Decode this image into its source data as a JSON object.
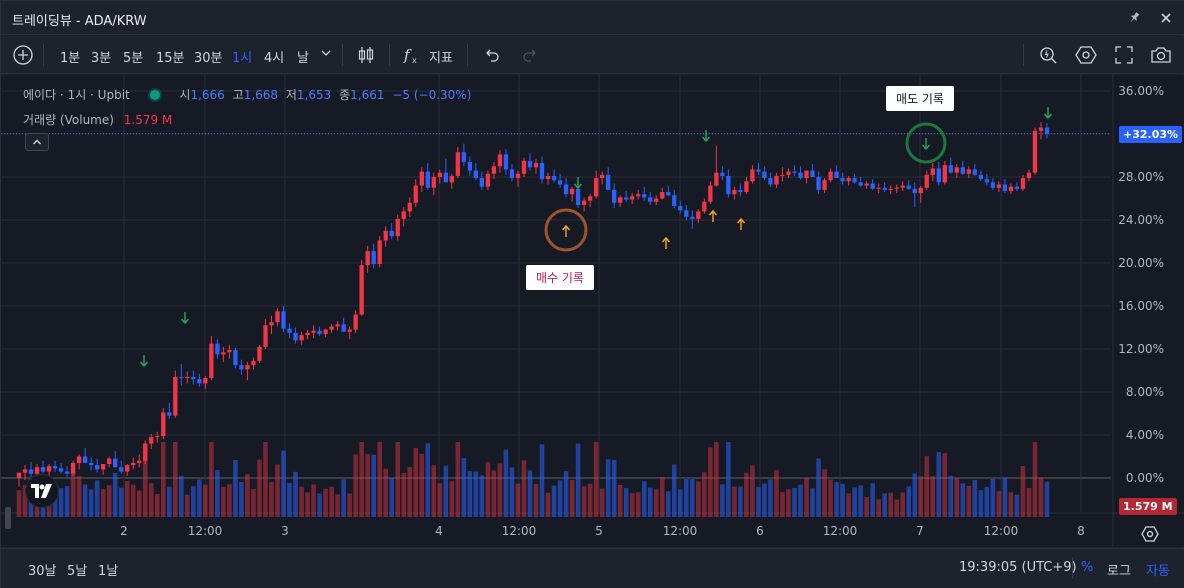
{
  "window": {
    "title": "트레이딩뷰 - ADA/KRW",
    "pin_icon": "pin-icon",
    "close_icon": "close-icon"
  },
  "toolbar": {
    "add_icon": "plus-circle-icon",
    "intervals": [
      "1분",
      "3분",
      "5분",
      "15분",
      "30분",
      "1시",
      "4시",
      "날"
    ],
    "active_interval": "1시",
    "chart_type_icon": "candles-icon",
    "indicators_label": "지표",
    "undo_icon": "undo-icon",
    "redo_icon": "redo-icon",
    "right_icons": [
      "quick-search-icon",
      "settings-hex-icon",
      "fullscreen-icon",
      "camera-icon"
    ]
  },
  "legend": {
    "symbol": "에이다 · 1시 · Upbit",
    "status_color": "#089981",
    "o_label": "시",
    "o_value": "1,666",
    "h_label": "고",
    "h_value": "1,668",
    "l_label": "저",
    "l_value": "1,653",
    "c_label": "종",
    "c_value": "1,661",
    "change": "−5 (−0.30%)",
    "volume_label": "거래량 (Volume)",
    "volume_value": "1.579 M"
  },
  "annotations": {
    "buy_label": "매수 기록",
    "sell_label": "매도 기록"
  },
  "price_axis": {
    "labels": [
      "36.00%",
      "32.00%",
      "28.00%",
      "24.00%",
      "20.00%",
      "16.00%",
      "12.00%",
      "8.00%",
      "4.00%",
      "0.00%"
    ],
    "last_tag": "+32.03%",
    "volume_tag": "1.579 M"
  },
  "time_axis": {
    "labels": [
      "2",
      "12:00",
      "3",
      "4",
      "12:00",
      "5",
      "12:00",
      "6",
      "12:00",
      "7",
      "12:00",
      "8"
    ]
  },
  "bottom": {
    "ranges": [
      "30날",
      "5날",
      "1날"
    ],
    "clock": "19:39:05 (UTC+9)",
    "percent_label": "%",
    "log_label": "로그",
    "auto_label": "자동"
  },
  "colors": {
    "up": "#f23645",
    "down": "#2962ff",
    "background": "#161a25",
    "grid": "#2a2e39",
    "accent": "#2962ff",
    "buy_circle": "#a0522d",
    "sell_circle": "#1b7a3a"
  },
  "chart_data": {
    "type": "candlestick",
    "yaxis": "percent",
    "ylim": [
      -2,
      38
    ],
    "last_value_pct": 32.03,
    "candles_pct": [
      [
        0,
        0.2,
        -0.8,
        0.5
      ],
      [
        0.5,
        1.2,
        -0.2,
        0.8
      ],
      [
        0.8,
        1.5,
        0.1,
        0.4
      ],
      [
        0.4,
        1.3,
        0.1,
        1.0
      ],
      [
        1.0,
        1.6,
        0.5,
        0.6
      ],
      [
        0.6,
        1.3,
        0.2,
        1.1
      ],
      [
        1.1,
        1.6,
        0.6,
        0.9
      ],
      [
        0.9,
        1.4,
        0.4,
        0.6
      ],
      [
        0.6,
        1.1,
        0.1,
        0.4
      ],
      [
        0.4,
        1.6,
        0.2,
        1.4
      ],
      [
        1.4,
        2.2,
        0.8,
        2.0
      ],
      [
        2.0,
        2.8,
        1.5,
        1.4
      ],
      [
        1.4,
        1.9,
        0.7,
        1.2
      ],
      [
        1.2,
        1.8,
        0.5,
        0.8
      ],
      [
        0.8,
        1.3,
        0.3,
        1.3
      ],
      [
        1.3,
        2.0,
        1.0,
        1.8
      ],
      [
        1.8,
        2.5,
        1.3,
        1.0
      ],
      [
        1.0,
        1.6,
        0.4,
        0.6
      ],
      [
        0.6,
        1.3,
        0.2,
        1.2
      ],
      [
        1.2,
        1.9,
        0.8,
        1.4
      ],
      [
        1.4,
        2.2,
        1.0,
        1.6
      ],
      [
        1.6,
        3.5,
        1.3,
        3.2
      ],
      [
        3.2,
        4.1,
        2.7,
        3.8
      ],
      [
        3.8,
        4.3,
        3.3,
        3.9
      ],
      [
        3.9,
        6.5,
        3.6,
        6.1
      ],
      [
        6.1,
        7.0,
        5.5,
        5.8
      ],
      [
        5.8,
        10.0,
        5.6,
        9.4
      ],
      [
        9.4,
        10.6,
        8.6,
        9.3
      ],
      [
        9.3,
        9.9,
        8.8,
        9.4
      ],
      [
        9.4,
        10.0,
        8.7,
        9.2
      ],
      [
        9.2,
        9.7,
        8.5,
        8.8
      ],
      [
        8.8,
        9.5,
        8.3,
        9.3
      ],
      [
        9.3,
        13.2,
        9.1,
        12.5
      ],
      [
        12.5,
        12.9,
        11.1,
        11.5
      ],
      [
        11.5,
        12.2,
        10.8,
        11.7
      ],
      [
        11.7,
        12.4,
        11.1,
        11.9
      ],
      [
        11.9,
        12.1,
        10.2,
        10.5
      ],
      [
        10.5,
        11.0,
        9.6,
        10.1
      ],
      [
        10.1,
        10.8,
        9.1,
        10.5
      ],
      [
        10.5,
        11.2,
        10.1,
        10.9
      ],
      [
        10.9,
        12.4,
        10.7,
        12.2
      ],
      [
        12.2,
        14.8,
        12.0,
        14.2
      ],
      [
        14.2,
        15.1,
        13.4,
        14.5
      ],
      [
        14.5,
        15.8,
        14.1,
        15.5
      ],
      [
        15.5,
        16.0,
        13.6,
        13.9
      ],
      [
        13.9,
        14.4,
        13.0,
        13.5
      ],
      [
        13.5,
        14.0,
        12.5,
        12.8
      ],
      [
        12.8,
        13.6,
        12.4,
        13.3
      ],
      [
        13.3,
        13.8,
        12.9,
        13.5
      ],
      [
        13.5,
        14.2,
        13.0,
        13.7
      ],
      [
        13.7,
        14.1,
        13.2,
        13.4
      ],
      [
        13.4,
        13.9,
        13.1,
        13.8
      ],
      [
        13.8,
        14.3,
        13.5,
        14.1
      ],
      [
        14.1,
        14.6,
        13.7,
        14.3
      ],
      [
        14.3,
        14.9,
        13.9,
        13.6
      ],
      [
        13.6,
        14.1,
        12.9,
        13.8
      ],
      [
        13.8,
        15.6,
        13.5,
        15.2
      ],
      [
        15.2,
        20.3,
        15.1,
        19.8
      ],
      [
        19.8,
        21.6,
        19.1,
        21.1
      ],
      [
        21.1,
        21.8,
        19.5,
        19.9
      ],
      [
        19.9,
        22.5,
        19.6,
        22.1
      ],
      [
        22.1,
        23.4,
        21.5,
        23.0
      ],
      [
        23.0,
        23.7,
        22.2,
        22.5
      ],
      [
        22.5,
        24.5,
        22.1,
        24.1
      ],
      [
        24.1,
        25.2,
        23.4,
        24.8
      ],
      [
        24.8,
        26.1,
        24.3,
        25.6
      ],
      [
        25.6,
        27.8,
        25.2,
        27.2
      ],
      [
        27.2,
        28.9,
        26.6,
        28.5
      ],
      [
        28.5,
        29.3,
        26.8,
        27.0
      ],
      [
        27.0,
        28.4,
        26.3,
        28.0
      ],
      [
        28.0,
        28.7,
        27.4,
        28.4
      ],
      [
        28.4,
        29.7,
        28.1,
        27.5
      ],
      [
        27.5,
        28.3,
        26.9,
        28.1
      ],
      [
        28.1,
        30.8,
        27.9,
        30.3
      ],
      [
        30.3,
        31.1,
        29.0,
        29.4
      ],
      [
        29.4,
        29.9,
        28.1,
        28.6
      ],
      [
        28.6,
        29.3,
        27.7,
        27.9
      ],
      [
        27.9,
        28.5,
        26.8,
        27.1
      ],
      [
        27.1,
        28.6,
        26.8,
        28.3
      ],
      [
        28.3,
        29.4,
        27.8,
        29.0
      ],
      [
        29.0,
        30.5,
        28.4,
        30.1
      ],
      [
        30.1,
        30.6,
        28.2,
        28.7
      ],
      [
        28.7,
        29.2,
        27.6,
        27.9
      ],
      [
        27.9,
        28.6,
        27.1,
        28.3
      ],
      [
        28.3,
        29.8,
        28.0,
        29.5
      ],
      [
        29.5,
        30.2,
        28.6,
        28.9
      ],
      [
        28.9,
        29.7,
        28.3,
        29.3
      ],
      [
        29.3,
        29.9,
        27.4,
        27.8
      ],
      [
        27.8,
        28.4,
        27.3,
        28.1
      ],
      [
        28.1,
        28.7,
        27.5,
        27.7
      ],
      [
        27.7,
        28.3,
        27.0,
        27.3
      ],
      [
        27.3,
        27.9,
        26.1,
        26.4
      ],
      [
        26.4,
        27.1,
        25.7,
        26.9
      ],
      [
        26.9,
        27.5,
        25.1,
        25.4
      ],
      [
        25.4,
        26.1,
        24.8,
        25.8
      ],
      [
        25.8,
        26.4,
        25.2,
        26.2
      ],
      [
        26.2,
        28.6,
        26.0,
        27.9
      ],
      [
        27.9,
        28.5,
        27.3,
        28.2
      ],
      [
        28.2,
        28.9,
        27.4,
        26.8
      ],
      [
        26.8,
        27.4,
        25.1,
        25.6
      ],
      [
        25.6,
        26.3,
        25.2,
        26.1
      ],
      [
        26.1,
        26.7,
        25.7,
        25.9
      ],
      [
        25.9,
        26.5,
        25.5,
        26.2
      ],
      [
        26.2,
        26.8,
        25.9,
        26.4
      ],
      [
        26.4,
        27.1,
        25.8,
        26.1
      ],
      [
        26.1,
        26.6,
        25.4,
        25.7
      ],
      [
        25.7,
        26.3,
        25.4,
        26.0
      ],
      [
        26.0,
        27.0,
        25.9,
        26.6
      ],
      [
        26.6,
        27.2,
        26.2,
        26.3
      ],
      [
        26.3,
        26.8,
        25.1,
        25.3
      ],
      [
        25.3,
        25.8,
        24.6,
        24.9
      ],
      [
        24.9,
        25.4,
        24.0,
        24.3
      ],
      [
        24.3,
        24.9,
        23.2,
        24.1
      ],
      [
        24.1,
        25.0,
        23.7,
        24.8
      ],
      [
        24.8,
        26.0,
        24.6,
        25.7
      ],
      [
        25.7,
        27.6,
        25.5,
        27.2
      ],
      [
        27.2,
        30.9,
        27.1,
        28.4
      ],
      [
        28.4,
        29.0,
        27.7,
        28.1
      ],
      [
        28.1,
        28.7,
        26.1,
        26.4
      ],
      [
        26.4,
        27.1,
        25.9,
        26.8
      ],
      [
        26.8,
        27.4,
        26.2,
        26.6
      ],
      [
        26.6,
        28.0,
        26.4,
        27.6
      ],
      [
        27.6,
        29.1,
        27.4,
        28.7
      ],
      [
        28.7,
        29.3,
        28.2,
        28.5
      ],
      [
        28.5,
        29.0,
        27.7,
        27.9
      ],
      [
        27.9,
        28.4,
        27.1,
        27.3
      ],
      [
        27.3,
        28.4,
        27.0,
        28.1
      ],
      [
        28.1,
        28.9,
        27.6,
        28.2
      ],
      [
        28.2,
        28.8,
        27.9,
        28.5
      ],
      [
        28.5,
        29.1,
        28.1,
        28.4
      ],
      [
        28.4,
        29.0,
        27.8,
        27.9
      ],
      [
        27.9,
        28.5,
        27.4,
        28.6
      ],
      [
        28.6,
        29.2,
        28.2,
        28.0
      ],
      [
        28.0,
        28.5,
        26.4,
        26.8
      ],
      [
        26.8,
        27.9,
        26.5,
        27.7
      ],
      [
        27.7,
        28.8,
        27.5,
        28.5
      ],
      [
        28.5,
        29.1,
        28.0,
        27.9
      ],
      [
        27.9,
        28.4,
        27.3,
        27.6
      ],
      [
        27.6,
        28.1,
        27.2,
        27.9
      ],
      [
        27.9,
        28.3,
        27.4,
        27.5
      ],
      [
        27.5,
        28.0,
        27.1,
        27.2
      ],
      [
        27.2,
        27.6,
        26.9,
        27.4
      ],
      [
        27.4,
        27.8,
        26.8,
        26.9
      ],
      [
        26.9,
        27.4,
        26.5,
        27.0
      ],
      [
        27.0,
        27.5,
        26.6,
        26.8
      ],
      [
        26.8,
        27.2,
        26.4,
        26.9
      ],
      [
        26.9,
        27.3,
        26.5,
        27.0
      ],
      [
        27.0,
        27.6,
        26.7,
        27.2
      ],
      [
        27.2,
        27.7,
        26.8,
        26.9
      ],
      [
        26.9,
        27.5,
        25.2,
        26.5
      ],
      [
        26.5,
        27.2,
        25.6,
        27.0
      ],
      [
        27.0,
        28.6,
        26.8,
        28.2
      ],
      [
        28.2,
        29.3,
        27.6,
        28.8
      ],
      [
        28.8,
        29.4,
        27.2,
        27.5
      ],
      [
        27.5,
        29.5,
        27.3,
        29.1
      ],
      [
        29.1,
        29.8,
        28.3,
        28.4
      ],
      [
        28.4,
        29.2,
        27.9,
        28.9
      ],
      [
        28.9,
        29.5,
        28.2,
        28.3
      ],
      [
        28.3,
        29.0,
        27.9,
        28.7
      ],
      [
        28.7,
        29.2,
        28.1,
        28.2
      ],
      [
        28.2,
        28.6,
        27.6,
        27.8
      ],
      [
        27.8,
        28.3,
        27.2,
        27.5
      ],
      [
        27.5,
        27.9,
        26.8,
        27.0
      ],
      [
        27.0,
        27.6,
        26.6,
        27.3
      ],
      [
        27.3,
        27.8,
        26.5,
        26.7
      ],
      [
        26.7,
        27.4,
        26.4,
        27.1
      ],
      [
        27.1,
        27.5,
        26.7,
        26.9
      ],
      [
        26.9,
        28.2,
        26.7,
        27.9
      ],
      [
        27.9,
        28.7,
        27.6,
        28.4
      ],
      [
        28.4,
        32.6,
        28.2,
        32.3
      ],
      [
        32.3,
        33.1,
        31.5,
        32.6
      ],
      [
        32.6,
        33.0,
        31.6,
        32.03
      ]
    ]
  }
}
